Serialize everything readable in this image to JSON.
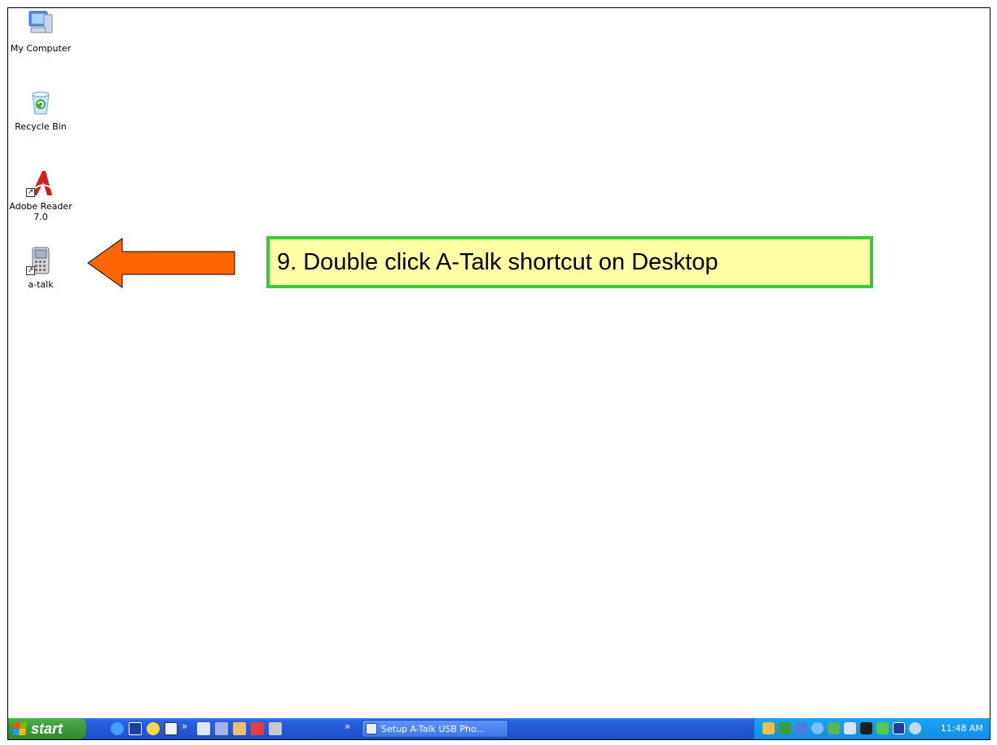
{
  "desktop": {
    "icons": [
      {
        "label": "My Computer",
        "icon": "my-computer-icon"
      },
      {
        "label": "Recycle Bin",
        "icon": "recycle-bin-icon"
      },
      {
        "label": "Adobe Reader\n7.0",
        "icon": "adobe-reader-icon"
      },
      {
        "label": "a-talk",
        "icon": "a-talk-phone-icon"
      }
    ]
  },
  "callout": {
    "text": "9. Double click A-Talk shortcut on Desktop",
    "border_color": "#3bc83b",
    "background_color": "#ffffa5"
  },
  "arrow": {
    "color": "#ff6600",
    "direction": "left"
  },
  "taskbar": {
    "start_label": "start",
    "quick_launch": [
      "internet-explorer-icon",
      "ve-icon",
      "clock-icon",
      "app-icon",
      "chevron-icon",
      "printer-icon",
      "tool-icon",
      "paint-icon",
      "shield-icon",
      "user-icon",
      "chevron-icon"
    ],
    "task_button_label": "Setup A-Talk USB Pho...",
    "tray_icons": [
      "key-icon",
      "network-icon",
      "sync-icon",
      "globe-icon",
      "messenger-icon",
      "usb-icon",
      "volume-icon",
      "battery-icon",
      "ve-tray-icon",
      "settings-icon"
    ],
    "clock": "11:48 AM"
  }
}
